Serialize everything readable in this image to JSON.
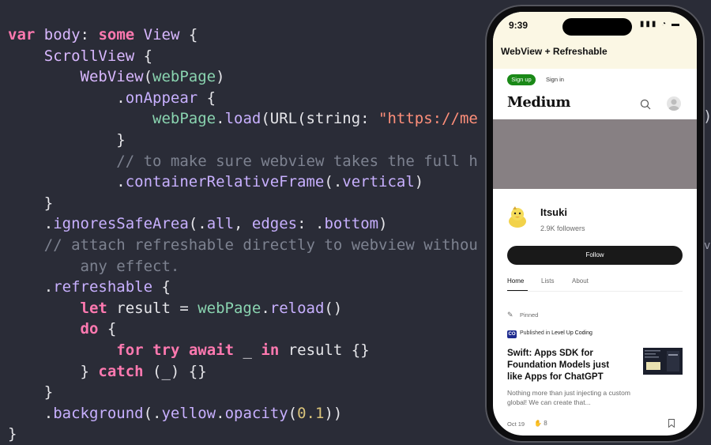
{
  "code": {
    "lines": [
      [
        {
          "t": "var",
          "c": "k"
        },
        {
          "t": " ",
          "c": "p"
        },
        {
          "t": "body",
          "c": "t"
        },
        {
          "t": ": ",
          "c": "p"
        },
        {
          "t": "some",
          "c": "k"
        },
        {
          "t": " ",
          "c": "p"
        },
        {
          "t": "View",
          "c": "t"
        },
        {
          "t": " {",
          "c": "p"
        }
      ],
      [
        {
          "t": "    ",
          "c": "p"
        },
        {
          "t": "ScrollView",
          "c": "t"
        },
        {
          "t": " {",
          "c": "p"
        }
      ],
      [
        {
          "t": "        ",
          "c": "p"
        },
        {
          "t": "WebView",
          "c": "t"
        },
        {
          "t": "(",
          "c": "p"
        },
        {
          "t": "webPage",
          "c": "v"
        },
        {
          "t": ")",
          "c": "p"
        }
      ],
      [
        {
          "t": "            .",
          "c": "p"
        },
        {
          "t": "onAppear",
          "c": "m"
        },
        {
          "t": " {",
          "c": "p"
        }
      ],
      [
        {
          "t": "                ",
          "c": "p"
        },
        {
          "t": "webPage",
          "c": "v"
        },
        {
          "t": ".",
          "c": "p"
        },
        {
          "t": "load",
          "c": "m"
        },
        {
          "t": "(URL(string: ",
          "c": "p"
        },
        {
          "t": "\"https://me",
          "c": "s"
        }
      ],
      [
        {
          "t": "            }",
          "c": "p"
        }
      ],
      [
        {
          "t": "            ",
          "c": "p"
        },
        {
          "t": "// to make sure webview takes the full h",
          "c": "c"
        }
      ],
      [
        {
          "t": "            .",
          "c": "p"
        },
        {
          "t": "containerRelativeFrame",
          "c": "m"
        },
        {
          "t": "(.",
          "c": "p"
        },
        {
          "t": "vertical",
          "c": "m"
        },
        {
          "t": ")",
          "c": "p"
        }
      ],
      [
        {
          "t": "    }",
          "c": "p"
        }
      ],
      [
        {
          "t": "    .",
          "c": "p"
        },
        {
          "t": "ignoresSafeArea",
          "c": "m"
        },
        {
          "t": "(.",
          "c": "p"
        },
        {
          "t": "all",
          "c": "m"
        },
        {
          "t": ", ",
          "c": "p"
        },
        {
          "t": "edges",
          "c": "m"
        },
        {
          "t": ": .",
          "c": "p"
        },
        {
          "t": "bottom",
          "c": "m"
        },
        {
          "t": ")",
          "c": "p"
        }
      ],
      [
        {
          "t": "    ",
          "c": "p"
        },
        {
          "t": "// attach refreshable directly to webview withou",
          "c": "c"
        }
      ],
      [
        {
          "t": "        ",
          "c": "p"
        },
        {
          "t": "any effect.",
          "c": "c"
        }
      ],
      [
        {
          "t": "    .",
          "c": "p"
        },
        {
          "t": "refreshable",
          "c": "m"
        },
        {
          "t": " {",
          "c": "p"
        }
      ],
      [
        {
          "t": "        ",
          "c": "p"
        },
        {
          "t": "let",
          "c": "k"
        },
        {
          "t": " result = ",
          "c": "p"
        },
        {
          "t": "webPage",
          "c": "v"
        },
        {
          "t": ".",
          "c": "p"
        },
        {
          "t": "reload",
          "c": "m"
        },
        {
          "t": "()",
          "c": "p"
        }
      ],
      [
        {
          "t": "        ",
          "c": "p"
        },
        {
          "t": "do",
          "c": "k"
        },
        {
          "t": " {",
          "c": "p"
        }
      ],
      [
        {
          "t": "            ",
          "c": "p"
        },
        {
          "t": "for",
          "c": "k"
        },
        {
          "t": " ",
          "c": "p"
        },
        {
          "t": "try",
          "c": "k"
        },
        {
          "t": " ",
          "c": "p"
        },
        {
          "t": "await",
          "c": "k"
        },
        {
          "t": " _ ",
          "c": "p"
        },
        {
          "t": "in",
          "c": "k"
        },
        {
          "t": " result {}",
          "c": "p"
        }
      ],
      [
        {
          "t": "        } ",
          "c": "p"
        },
        {
          "t": "catch",
          "c": "k"
        },
        {
          "t": " (_) {}",
          "c": "p"
        }
      ],
      [
        {
          "t": "    }",
          "c": "p"
        }
      ],
      [
        {
          "t": "    .",
          "c": "p"
        },
        {
          "t": "background",
          "c": "m"
        },
        {
          "t": "(.",
          "c": "p"
        },
        {
          "t": "yellow",
          "c": "m"
        },
        {
          "t": ".",
          "c": "p"
        },
        {
          "t": "opacity",
          "c": "m"
        },
        {
          "t": "(",
          "c": "p"
        },
        {
          "t": "0.1",
          "c": "n"
        },
        {
          "t": "))",
          "c": "p"
        }
      ],
      [
        {
          "t": "}",
          "c": "p"
        }
      ]
    ],
    "edge_right_1": ")",
    "edge_right_2": "v"
  },
  "phone": {
    "status": {
      "time": "9:39",
      "icons": "▮▮▮ ◔ ▬"
    },
    "nav_title": "WebView + Refreshable",
    "auth": {
      "signup": "Sign up",
      "signin": "Sign in"
    },
    "logo": "Medium",
    "icons": {
      "search": "search-icon",
      "avatar": "user-avatar-icon"
    },
    "profile": {
      "name": "Itsuki",
      "followers": "2.9K followers",
      "follow_label": "Follow"
    },
    "tabs": [
      {
        "label": "Home",
        "active": true
      },
      {
        "label": "Lists",
        "active": false
      },
      {
        "label": "About",
        "active": false
      }
    ],
    "pinned_label": "Pinned",
    "publication": {
      "prefix": "Published in",
      "name": "Level Up Coding",
      "logo_text": "CO"
    },
    "article": {
      "title": "Swift: Apps SDK for Foundation Models just like Apps for ChatGPT",
      "subtitle": "Nothing more than just injecting a custom global! We can create that...",
      "date": "Oct 19",
      "claps": "8"
    },
    "colors": {
      "accent_green": "#1a8917",
      "banner": "#878083",
      "top_tint": "#fbf7e4"
    }
  }
}
